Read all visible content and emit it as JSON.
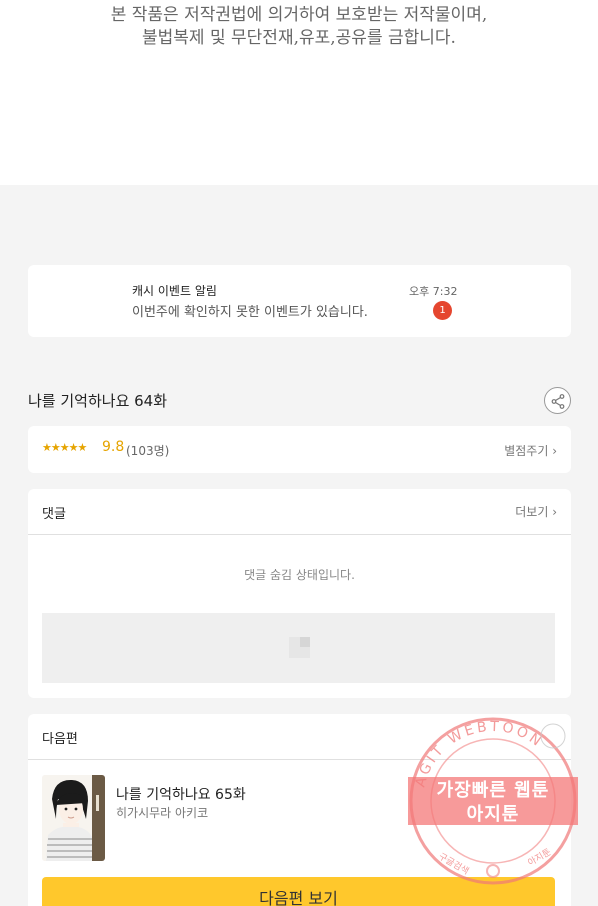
{
  "copyright": {
    "line1": "본 작품은 저작권법에 의거하여 보호받는 저작물이며,",
    "line2": "불법복제 및 무단전재,유포,공유를 금합니다."
  },
  "notification": {
    "title": "캐시 이벤트 알림",
    "message": "이번주에 확인하지 못한 이벤트가 있습니다.",
    "time": "오후 7:32",
    "badge_count": "1",
    "badge_color": "#e5462f"
  },
  "episode": {
    "title": "나를 기억하나요 64화",
    "share_icon": "share-icon"
  },
  "rating": {
    "stars": "★★★★★",
    "score": "9.8",
    "count": "(103명)",
    "rate_link": "별점주기 ›",
    "accent_color": "#e6a400"
  },
  "comments": {
    "title": "댓글",
    "more_label": "더보기 ›",
    "hidden_message": "댓글 숨김 상태입니다."
  },
  "next_episode": {
    "section_title": "다음편",
    "title": "나를 기억하나요 65화",
    "author": "히가시무라 아키코",
    "button_label": "다음편 보기",
    "button_color": "#ffc82c"
  },
  "watermark": {
    "ring_text": "AGIT WEBTOON",
    "line1": "가장빠른 웹툰",
    "line2": "아지툰",
    "bottom_left": "구글검색",
    "bottom_right": "아지툰"
  }
}
